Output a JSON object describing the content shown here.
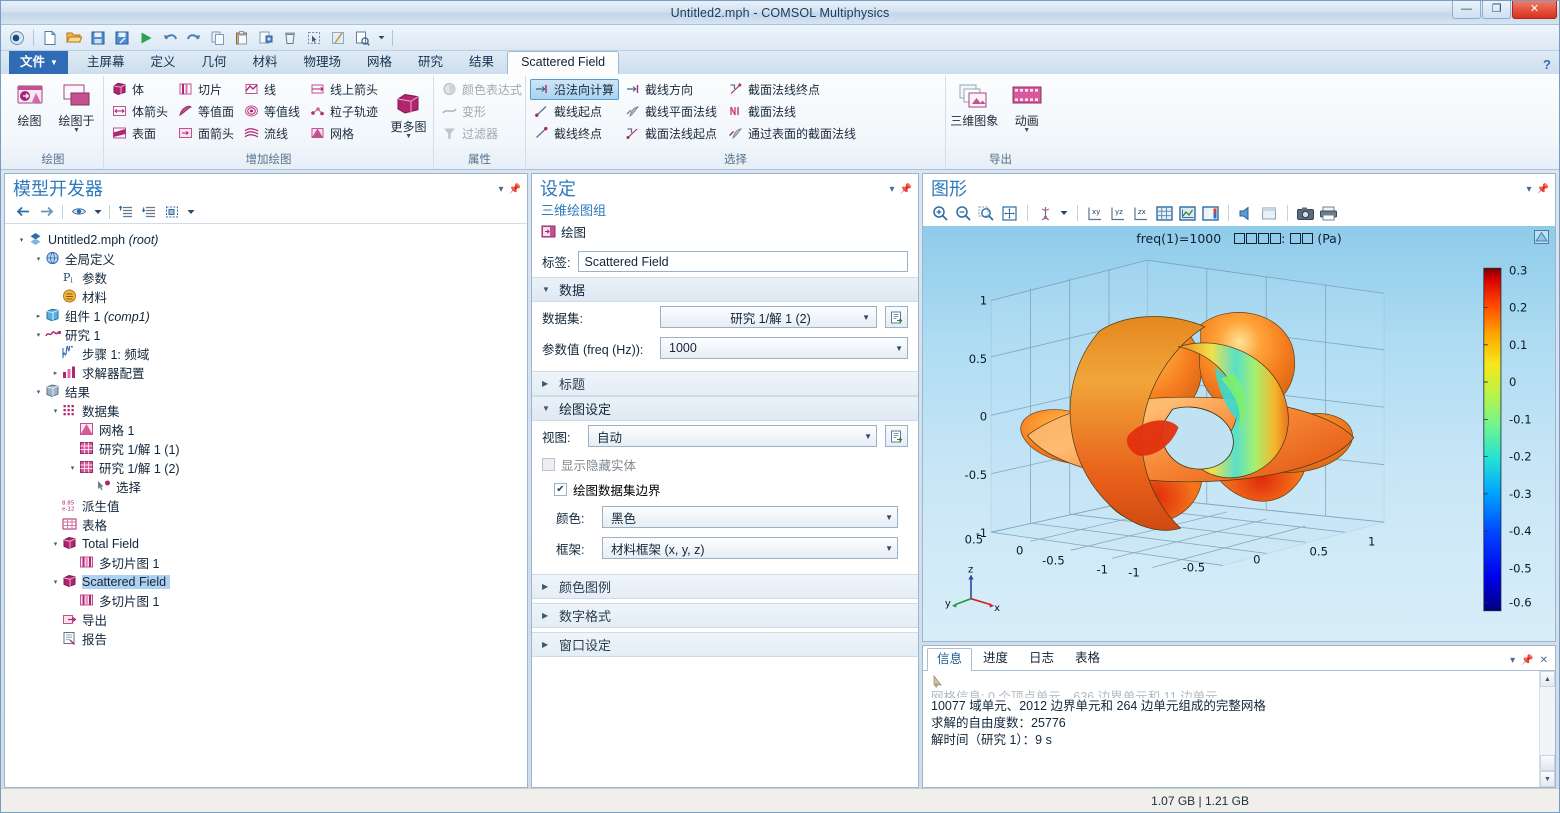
{
  "window": {
    "title": "Untitled2.mph - COMSOL Multiphysics",
    "minimize": "—",
    "maximize": "❐",
    "close": "✕"
  },
  "quick_access": [
    {
      "name": "app-menu-icon",
      "title": "COMSOL"
    },
    {
      "name": "new-icon",
      "title": "新建"
    },
    {
      "name": "open-icon",
      "title": "打开"
    },
    {
      "name": "save-icon",
      "title": "保存"
    },
    {
      "name": "save-as-icon",
      "title": "另存为"
    },
    {
      "name": "compute-icon",
      "title": "计算"
    },
    {
      "name": "undo-icon",
      "title": "撤销"
    },
    {
      "name": "redo-icon",
      "title": "重做"
    },
    {
      "name": "copy-icon",
      "title": "复制"
    },
    {
      "name": "paste-icon",
      "title": "粘贴"
    },
    {
      "name": "duplicate-icon",
      "title": "生成副本"
    },
    {
      "name": "delete-icon",
      "title": "删除"
    },
    {
      "name": "select-icon",
      "title": "选择"
    },
    {
      "name": "disable-icon",
      "title": "禁用"
    },
    {
      "name": "help-icon",
      "title": "帮助"
    },
    {
      "name": "dropdown-icon",
      "title": "更多"
    }
  ],
  "ribbon": {
    "tabs": [
      {
        "label": "文件",
        "id": "file"
      },
      {
        "label": "主屏幕",
        "id": "home"
      },
      {
        "label": "定义",
        "id": "definitions"
      },
      {
        "label": "几何",
        "id": "geometry"
      },
      {
        "label": "材料",
        "id": "materials"
      },
      {
        "label": "物理场",
        "id": "physics"
      },
      {
        "label": "网格",
        "id": "mesh"
      },
      {
        "label": "研究",
        "id": "study"
      },
      {
        "label": "结果",
        "id": "results"
      },
      {
        "label": "Scattered Field",
        "id": "scattered-field"
      }
    ],
    "active_tab": "Scattered Field",
    "help_label": "?",
    "groups": [
      {
        "title": "绘图",
        "big_buttons": [
          {
            "label": "绘图",
            "icon": "plot-icon",
            "has_caret": false
          },
          {
            "label": "绘图于",
            "icon": "plot-in-icon",
            "has_caret": true
          }
        ]
      },
      {
        "title": "增加绘图",
        "columns": [
          [
            {
              "label": "体",
              "icon": "volume-icon"
            },
            {
              "label": "体箭头",
              "icon": "arrow-volume-icon"
            },
            {
              "label": "表面",
              "icon": "surface-icon"
            }
          ],
          [
            {
              "label": "切片",
              "icon": "slice-icon"
            },
            {
              "label": "等值面",
              "icon": "isosurface-icon"
            },
            {
              "label": "面箭头",
              "icon": "arrow-surface-icon"
            }
          ],
          [
            {
              "label": "线",
              "icon": "line-icon"
            },
            {
              "label": "等值线",
              "icon": "contour-icon"
            },
            {
              "label": "流线",
              "icon": "streamline-icon"
            }
          ],
          [
            {
              "label": "线上箭头",
              "icon": "arrow-line-icon"
            },
            {
              "label": "粒子轨迹",
              "icon": "particle-trajectories-icon"
            },
            {
              "label": "网格",
              "icon": "mesh-plot-icon"
            }
          ]
        ],
        "big_buttons": [
          {
            "label": "更多图",
            "icon": "more-plots-icon",
            "has_caret": true
          }
        ]
      },
      {
        "title": "属性",
        "columns": [
          [
            {
              "label": "颜色表达式",
              "icon": "color-expression-icon",
              "disabled": true
            },
            {
              "label": "变形",
              "icon": "deformation-icon",
              "disabled": true
            },
            {
              "label": "过滤器",
              "icon": "filter-icon",
              "disabled": true
            }
          ]
        ]
      },
      {
        "title": "选择",
        "columns": [
          [
            {
              "label": "沿法向计算",
              "icon": "evaluate-normal-icon",
              "selected": true
            },
            {
              "label": "截线起点",
              "icon": "cut-line-start-icon"
            },
            {
              "label": "截线终点",
              "icon": "cut-line-end-icon"
            }
          ],
          [
            {
              "label": "截线方向",
              "icon": "cut-line-direction-icon"
            },
            {
              "label": "截线平面法线",
              "icon": "cut-plane-normal-icon"
            },
            {
              "label": "截面法线起点",
              "icon": "cut-plane-normal-start-icon"
            }
          ],
          [
            {
              "label": "截面法线终点",
              "icon": "cut-plane-normal-end-icon"
            },
            {
              "label": "截面法线",
              "icon": "cut-plane-normal2-icon"
            },
            {
              "label": "通过表面的截面法线",
              "icon": "cut-plane-through-surface-icon"
            }
          ]
        ]
      },
      {
        "title": "导出",
        "big_buttons": [
          {
            "label": "三维图象",
            "icon": "image-3d-icon",
            "has_caret": false
          },
          {
            "label": "动画",
            "icon": "animation-icon",
            "has_caret": true
          }
        ]
      }
    ]
  },
  "model_builder": {
    "title": "模型开发器",
    "toolbar": [
      {
        "name": "back-icon"
      },
      {
        "name": "forward-icon"
      },
      {
        "name": "show-icon"
      },
      {
        "name": "show-dropdown-icon"
      },
      {
        "name": "collapse-all-icon"
      },
      {
        "name": "expand-all-icon"
      },
      {
        "name": "root-node-icon"
      },
      {
        "name": "root-dropdown-icon"
      }
    ],
    "tree": [
      {
        "indent": 0,
        "twist": "▾",
        "icon": "root-icon",
        "label": "Untitled2.mph",
        "italic": " (root)"
      },
      {
        "indent": 1,
        "twist": "▾",
        "icon": "global-definitions-icon",
        "label": "全局定义",
        "italic": ""
      },
      {
        "indent": 2,
        "twist": "",
        "icon": "parameters-icon",
        "label": "参数",
        "italic": ""
      },
      {
        "indent": 2,
        "twist": "",
        "icon": "materials-global-icon",
        "label": "材料",
        "italic": ""
      },
      {
        "indent": 1,
        "twist": "▸",
        "icon": "component-icon",
        "label": "组件 1",
        "italic": " (comp1)"
      },
      {
        "indent": 1,
        "twist": "▾",
        "icon": "study-icon",
        "label": "研究 1",
        "italic": ""
      },
      {
        "indent": 2,
        "twist": "",
        "icon": "frequency-domain-icon",
        "label": "步骤 1: 频域",
        "italic": ""
      },
      {
        "indent": 2,
        "twist": "▸",
        "icon": "solver-config-icon",
        "label": "求解器配置",
        "italic": ""
      },
      {
        "indent": 1,
        "twist": "▾",
        "icon": "results-icon",
        "label": "结果",
        "italic": ""
      },
      {
        "indent": 2,
        "twist": "▾",
        "icon": "datasets-icon",
        "label": "数据集",
        "italic": ""
      },
      {
        "indent": 3,
        "twist": "",
        "icon": "mesh-dataset-icon",
        "label": "网格 1",
        "italic": ""
      },
      {
        "indent": 3,
        "twist": "",
        "icon": "solution-icon",
        "label": "研究 1/解 1 (1)",
        "italic": ""
      },
      {
        "indent": 3,
        "twist": "▾",
        "icon": "solution-icon",
        "label": "研究 1/解 1 (2)",
        "italic": ""
      },
      {
        "indent": 4,
        "twist": "",
        "icon": "selection-icon",
        "label": "选择",
        "italic": ""
      },
      {
        "indent": 2,
        "twist": "",
        "icon": "derived-values-icon",
        "label": "派生值",
        "italic": ""
      },
      {
        "indent": 2,
        "twist": "",
        "icon": "tables-icon",
        "label": "表格",
        "italic": ""
      },
      {
        "indent": 2,
        "twist": "▾",
        "icon": "plot-group-icon",
        "label": "Total Field",
        "italic": ""
      },
      {
        "indent": 3,
        "twist": "",
        "icon": "multislice-icon",
        "label": "多切片图 1",
        "italic": ""
      },
      {
        "indent": 2,
        "twist": "▾",
        "icon": "plot-group-icon",
        "label": "Scattered Field",
        "italic": "",
        "selected": true
      },
      {
        "indent": 3,
        "twist": "",
        "icon": "multislice-icon",
        "label": "多切片图 1",
        "italic": ""
      },
      {
        "indent": 2,
        "twist": "",
        "icon": "export-icon",
        "label": "导出",
        "italic": ""
      },
      {
        "indent": 2,
        "twist": "",
        "icon": "report-icon",
        "label": "报告",
        "italic": ""
      }
    ]
  },
  "settings": {
    "title": "设定",
    "subtitle": "三维绘图组",
    "node_label": "绘图",
    "label_caption": "标签:",
    "label_value": "Scattered Field",
    "sections": {
      "data": {
        "header": "数据",
        "expanded": true,
        "dataset_label": "数据集:",
        "dataset_value": "研究 1/解 1 (2)",
        "param_label": "参数值 (freq (Hz)):",
        "param_value": "1000"
      },
      "title": {
        "header": "标题",
        "expanded": false
      },
      "plot_settings": {
        "header": "绘图设定",
        "expanded": true,
        "view_label": "视图:",
        "view_value": "自动",
        "show_hidden_label": "显示隐藏实体",
        "show_hidden_checked": false,
        "show_hidden_disabled": true,
        "plot_dataset_edges_label": "绘图数据集边界",
        "plot_dataset_edges_checked": true,
        "color_label": "颜色:",
        "color_value": "黑色",
        "frame_label": "框架:",
        "frame_value": "材料框架 (x, y, z)"
      },
      "color_legend": {
        "header": "颜色图例",
        "expanded": false
      },
      "number_format": {
        "header": "数字格式",
        "expanded": false
      },
      "window_settings": {
        "header": "窗口设定",
        "expanded": false
      }
    }
  },
  "graphics": {
    "title": "图形",
    "toolbar": [
      {
        "name": "zoom-in-icon"
      },
      {
        "name": "zoom-out-icon"
      },
      {
        "name": "zoom-box-icon"
      },
      {
        "name": "zoom-extents-icon"
      },
      {
        "name": "sep"
      },
      {
        "name": "transparency-icon"
      },
      {
        "name": "transparency-dropdown-icon"
      },
      {
        "name": "sep"
      },
      {
        "name": "view-xy-icon",
        "label": "xy"
      },
      {
        "name": "view-yz-icon",
        "label": "yz"
      },
      {
        "name": "view-zx-icon",
        "label": "zx"
      },
      {
        "name": "grid-icon"
      },
      {
        "name": "axis-icon"
      },
      {
        "name": "legend-icon"
      },
      {
        "name": "sep"
      },
      {
        "name": "scene-light-icon"
      },
      {
        "name": "reset-view-icon"
      },
      {
        "name": "sep"
      },
      {
        "name": "snapshot-icon"
      },
      {
        "name": "print-icon"
      }
    ],
    "plot_title_prefix": "freq(1)=1000",
    "plot_title_suffix": "(Pa)",
    "plot_title_tofu_a": 4,
    "plot_title_tofu_b": 2,
    "axis_triad": {
      "x": "x",
      "y": "y",
      "z": "z"
    }
  },
  "chart_data": {
    "type": "heatmap",
    "title": "freq(1)=1000   多切片图: 声压 (Pa)",
    "description": "3D multislice plot of scattered acoustic pressure field on three orthogonal cut planes through a sphere-like lobed object",
    "colorbar": {
      "ticks": [
        0.3,
        0.2,
        0.1,
        0,
        -0.1,
        -0.2,
        -0.3,
        -0.4,
        -0.5,
        -0.6
      ],
      "tick_labels": [
        "0.3",
        "0.2",
        "0.1",
        "0",
        "-0.1",
        "-0.2",
        "-0.3",
        "-0.4",
        "-0.5",
        "-0.6"
      ],
      "min": -0.65,
      "max": 0.33,
      "unit": "Pa",
      "colormap": "jet"
    },
    "axes": {
      "z_ticks": [
        1,
        0.5,
        0,
        -0.5,
        -1
      ],
      "z_tick_labels": [
        "1",
        "0.5",
        "0",
        "-0.5",
        "-1"
      ],
      "x_ticks": [
        1,
        0.5,
        0,
        -0.5,
        -1
      ],
      "x_tick_labels": [
        "1",
        "0.5",
        "0",
        "-0.5",
        "-1"
      ],
      "y_ticks": [
        1,
        0.5,
        0,
        -0.5,
        -1
      ],
      "y_tick_labels": [
        "1",
        "0.5",
        "0",
        "-0.5",
        "-1"
      ],
      "xlim": [
        -1,
        1
      ],
      "ylim": [
        -1,
        1
      ],
      "zlim": [
        -1,
        1
      ],
      "grid": true
    },
    "legend_position": "right",
    "parameter": {
      "name": "freq",
      "value": 1000,
      "unit": "Hz"
    }
  },
  "messages": {
    "tabs": [
      {
        "label": "信息",
        "active": true
      },
      {
        "label": "进度",
        "active": false
      },
      {
        "label": "日志",
        "active": false
      },
      {
        "label": "表格",
        "active": false
      }
    ],
    "clipped_line": "网格信息: 0 个顶点单元、636 边界单元和 11 边单元",
    "lines": [
      "10077 域单元、2012 边界单元和 264 边单元组成的完整网格",
      "求解的自由度数：25776",
      "解时间（研究 1）：9 s"
    ]
  },
  "statusbar": {
    "memory": "1.07 GB | 1.21 GB"
  }
}
